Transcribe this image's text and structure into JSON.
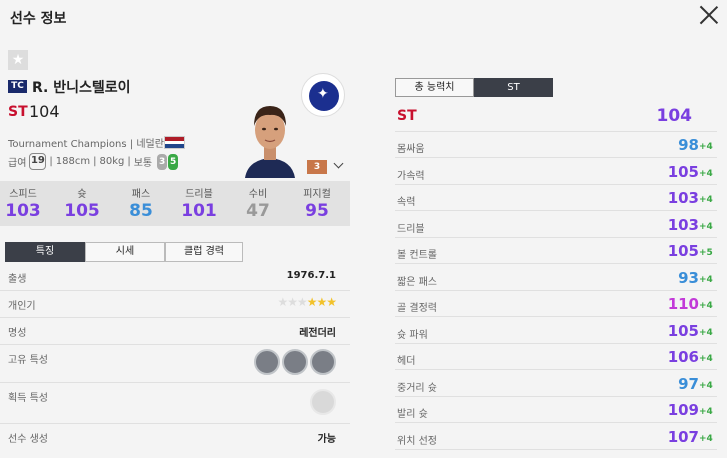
{
  "window": {
    "title": "선수 정보"
  },
  "player": {
    "season_badge": "TC",
    "name": "R. 반니스텔로이",
    "position": "ST",
    "ovr": "104",
    "season_name": "Tournament Champions",
    "nation": "네덜란드",
    "pay": "19",
    "pay_label": "급여",
    "height": "188cm",
    "weight": "80kg",
    "body": "보통",
    "left_foot": "3",
    "right_foot": "5",
    "enhance": "3"
  },
  "summary_stats": [
    {
      "label": "스피드",
      "value": "103",
      "color": "#7a3fe0"
    },
    {
      "label": "슛",
      "value": "105",
      "color": "#7a3fe0"
    },
    {
      "label": "패스",
      "value": "85",
      "color": "#3a8ed8"
    },
    {
      "label": "드리블",
      "value": "101",
      "color": "#7a3fe0"
    },
    {
      "label": "수비",
      "value": "47",
      "color": "#999999"
    },
    {
      "label": "피지컬",
      "value": "95",
      "color": "#7a3fe0"
    }
  ],
  "tabs": [
    "특징",
    "시세",
    "클럽 경력"
  ],
  "details": {
    "birth_label": "출생",
    "birth": "1976.7.1",
    "skill_label": "개인기",
    "skill_stars_filled": 3,
    "skill_stars_total": 6,
    "fame_label": "명성",
    "fame": "레전더리",
    "unique_traits_label": "고유 특성",
    "acquired_traits_label": "획득 특성",
    "generation_label": "선수 생성",
    "generation": "가능"
  },
  "right_tabs": [
    "총 능력치",
    "ST"
  ],
  "main_stat": {
    "label": "ST",
    "value": "104"
  },
  "stats": [
    {
      "label": "몸싸움",
      "value": "98",
      "bonus": "+4",
      "color": "#3a8ed8"
    },
    {
      "label": "가속력",
      "value": "105",
      "bonus": "+4",
      "color": "#7a3fe0"
    },
    {
      "label": "속력",
      "value": "103",
      "bonus": "+4",
      "color": "#7a3fe0"
    },
    {
      "label": "드리블",
      "value": "103",
      "bonus": "+4",
      "color": "#7a3fe0"
    },
    {
      "label": "볼 컨트롤",
      "value": "105",
      "bonus": "+5",
      "color": "#7a3fe0"
    },
    {
      "label": "짧은 패스",
      "value": "93",
      "bonus": "+4",
      "color": "#3a8ed8"
    },
    {
      "label": "골 결정력",
      "value": "110",
      "bonus": "+4",
      "color": "#c23ad8"
    },
    {
      "label": "슛 파워",
      "value": "105",
      "bonus": "+4",
      "color": "#7a3fe0"
    },
    {
      "label": "헤더",
      "value": "106",
      "bonus": "+4",
      "color": "#7a3fe0"
    },
    {
      "label": "중거리 슛",
      "value": "97",
      "bonus": "+4",
      "color": "#3a8ed8"
    },
    {
      "label": "발리 슛",
      "value": "109",
      "bonus": "+4",
      "color": "#7a3fe0"
    },
    {
      "label": "위치 선정",
      "value": "107",
      "bonus": "+4",
      "color": "#7a3fe0"
    }
  ]
}
